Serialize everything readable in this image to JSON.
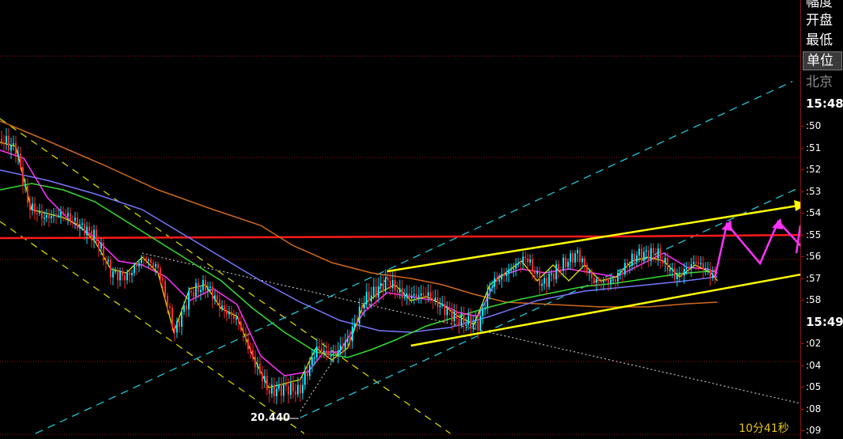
{
  "chart_data": {
    "type": "candlestick",
    "low_label": "20.440",
    "timer": "10分41秒",
    "colors": {
      "up": "#00e5ff",
      "down": "#ff2a2a",
      "ma_fast": "#e6e600",
      "ma_mid": "#ff33ff",
      "ma_slow": "#33dd33",
      "ma_long": "#7777ff",
      "ma_very_long": "#d2691e",
      "resistance": "#ff1a1a",
      "channel_up": "#22c8d8",
      "channel_down": "#d6d600",
      "trend": "#ffff00",
      "forecast": "#ff33ff"
    }
  },
  "sidebar": {
    "labels": [
      "幅度",
      "开盘",
      "最低"
    ],
    "unit_button": "单位",
    "timezone": "北京",
    "time_major_1": "15:48",
    "ticks_1": [
      ":50",
      ":51",
      ":52",
      ":53",
      ":54",
      ":55",
      ":56",
      ":57",
      ":58"
    ],
    "time_major_2": "15:49",
    "ticks_2": [
      ":02",
      ":04",
      ":05",
      ":08",
      ":09"
    ]
  }
}
